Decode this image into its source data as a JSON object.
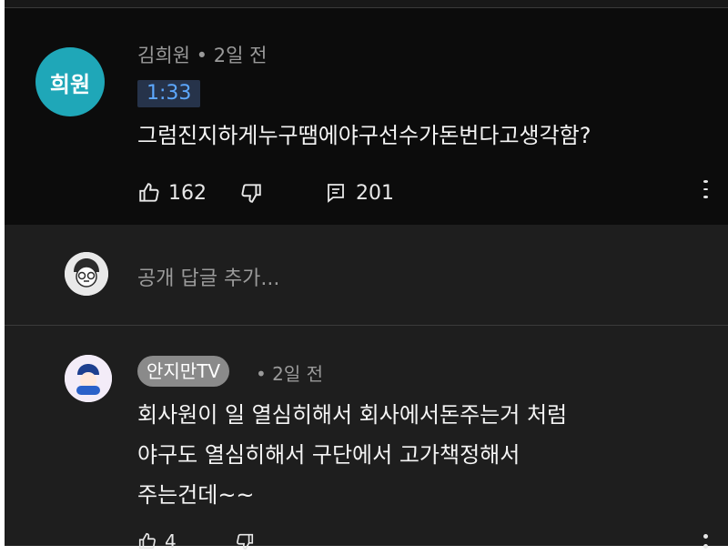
{
  "comment_main": {
    "avatar_text": "희원",
    "author": "김희원",
    "time": "2일 전",
    "timestamp_chip": "1:33",
    "text": "그럼진지하게누구땜에야구선수가돈번다고생각함?",
    "likes": "162",
    "replies": "201"
  },
  "reply_bar": {
    "placeholder": "공개 답글 추가..."
  },
  "comment_second": {
    "channel": "안지만TV",
    "time": "2일 전",
    "lines": [
      "회사원이 일 열심히해서 회사에서돈주는거 처럼",
      "야구도 열심히해서 구단에서 고가책정해서",
      "주는건데~~"
    ],
    "likes": "4"
  },
  "colors": {
    "background": "#1e1e1e",
    "comment_highlight": "#0c0c0c",
    "avatar_teal": "#1fa7b8",
    "timestamp_blue": "#5da8ff",
    "muted_text": "#9a9a9a"
  },
  "icons": [
    "like-icon",
    "dislike-icon",
    "reply-icon",
    "more-icon",
    "user-avatar"
  ]
}
